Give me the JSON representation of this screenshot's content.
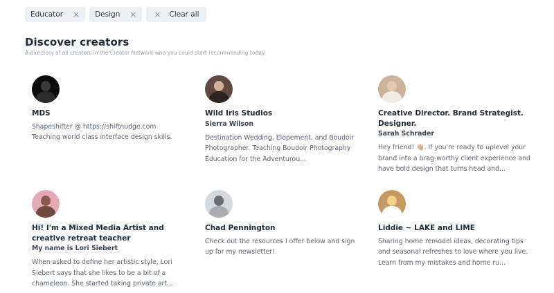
{
  "filters": {
    "chips": [
      {
        "label": "Educator"
      },
      {
        "label": "Design"
      }
    ],
    "clear_label": "Clear all",
    "remove_glyph": "×"
  },
  "page": {
    "title": "Discover creators",
    "subtitle": "A directory of all creators in the Creator Network who you could start recommending today."
  },
  "creators": [
    {
      "name": "MDS",
      "subname": "",
      "description": "Shapeshifter @ https://shiftnudge.com Teaching world class interface design skills.",
      "avatar": {
        "bg": "#0b0b0b",
        "head": "#3a3a3a",
        "body": "#2a2a2a"
      }
    },
    {
      "name": "Wild Iris Studios",
      "subname": "Sierra Wilson",
      "description": "Destination Wedding, Elopement, and Boudoir Photographer. Teaching Boudoir Photography Education for the Adventurou...",
      "avatar": {
        "bg": "#5e4a40",
        "head": "#d3b29a",
        "body": "#2b2420"
      }
    },
    {
      "name": "Creative Director. Brand Strategist. Designer.",
      "subname": "Sarah Schrader",
      "description": "Hey friend! 👋🏼. If you're ready to uplevel your brand into a brag-worthy client experience and have bold design that turns head and...",
      "avatar": {
        "bg": "#cbb49a",
        "head": "#e4c9ae",
        "body": "#f1ede6"
      }
    },
    {
      "name": "Hi! I'm a Mixed Media Artist and creative retreat teacher",
      "subname": "My name is Lori Siebert",
      "description": "When asked to define her artistic style, Lori Siebert says that she likes to be a bit of a chameleon. She started taking private art...",
      "avatar": {
        "bg": "#e6a9b6",
        "head": "#8a5b4c",
        "body": "#6e4a3f"
      }
    },
    {
      "name": "Chad Pennington",
      "subname": "",
      "description": "Check out the resources I offer below and sign up for my newsletter!",
      "avatar": {
        "bg": "#d6d9dc",
        "head": "#6b6f73",
        "body": "#a9adb1"
      }
    },
    {
      "name": "Liddie ~ LAKE and LIME",
      "subname": "",
      "description": "Sharing home remodel ideas, decorating tips and seasonal refreshes to love where you live. Learn from my mistakes and home ru...",
      "avatar": {
        "bg": "#c49a62",
        "head": "#f0d28a",
        "body": "#ffffff"
      }
    }
  ]
}
